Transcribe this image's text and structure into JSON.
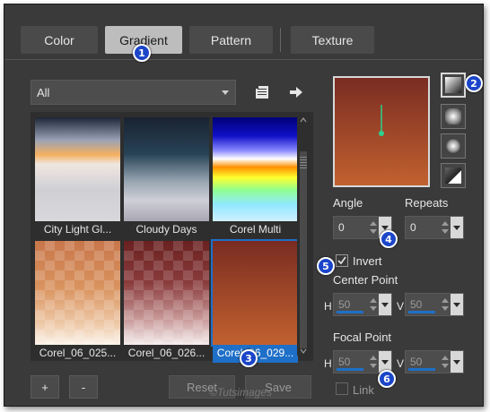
{
  "tabs": [
    {
      "label": "Color",
      "active": false
    },
    {
      "label": "Gradient",
      "active": true
    },
    {
      "label": "Pattern",
      "active": false
    },
    {
      "label": "Texture",
      "active": false
    }
  ],
  "badges": [
    "1",
    "2",
    "3",
    "4",
    "5",
    "6"
  ],
  "category_dropdown": {
    "selected": "All"
  },
  "toolbar_icons": [
    "library-menu-icon",
    "arrow-right-icon"
  ],
  "swatches": [
    {
      "label": "City Light Gl...",
      "selected": false
    },
    {
      "label": "Cloudy Days",
      "selected": false
    },
    {
      "label": "Corel Multi",
      "selected": false
    },
    {
      "label": "Corel_06_025...",
      "selected": false
    },
    {
      "label": "Corel_06_026...",
      "selected": false
    },
    {
      "label": "Corel_06_029...",
      "selected": true
    }
  ],
  "bottom_buttons": {
    "add": "+",
    "remove": "-",
    "reset": "Reset",
    "save": "Save"
  },
  "watermark": "©Tutsimages",
  "gradient_styles": [
    "linear",
    "rectangular",
    "radial",
    "sunburst"
  ],
  "angle": {
    "label": "Angle",
    "value": "0"
  },
  "repeats": {
    "label": "Repeats",
    "value": "0"
  },
  "invert": {
    "label": "Invert",
    "checked": true
  },
  "center_point": {
    "label": "Center Point",
    "h_label": "H",
    "h_value": "50",
    "v_label": "V",
    "v_value": "50"
  },
  "focal_point": {
    "label": "Focal Point",
    "h_label": "H",
    "h_value": "50",
    "v_label": "V",
    "v_value": "50"
  },
  "link": {
    "label": "Link",
    "checked": false
  },
  "colors": {
    "accent": "#1e6fc8",
    "badge": "#1b45c9",
    "panel": "#3a3a3a",
    "gradient_top": "#7a2c22",
    "gradient_bottom": "#c1612f",
    "handle": "#2bd18c"
  }
}
